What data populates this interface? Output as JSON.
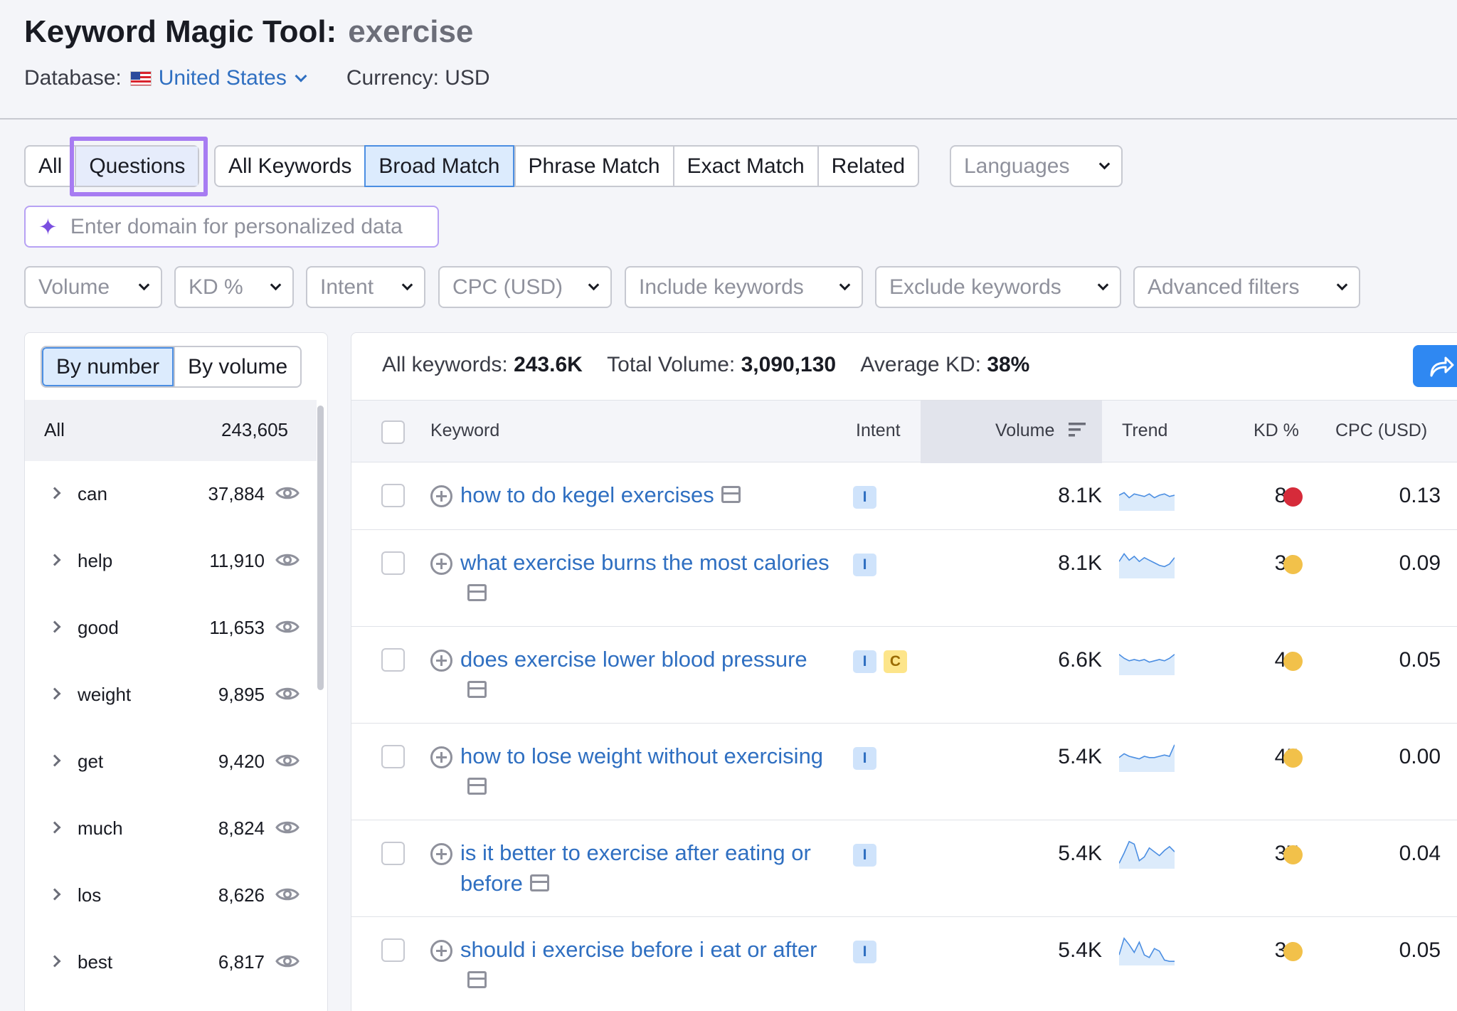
{
  "header": {
    "title": "Keyword Magic Tool:",
    "keyword": "exercise",
    "database_label": "Database:",
    "database_value": "United States",
    "currency": "Currency: USD"
  },
  "tabs_group1": [
    "All",
    "Questions"
  ],
  "tabs_group2": [
    "All Keywords",
    "Broad Match",
    "Phrase Match",
    "Exact Match",
    "Related"
  ],
  "languages_label": "Languages",
  "domain_input_placeholder": "Enter domain for personalized data",
  "filters": [
    "Volume",
    "KD %",
    "Intent",
    "CPC (USD)",
    "Include keywords",
    "Exclude keywords",
    "Advanced filters"
  ],
  "left_panel": {
    "toggle": [
      "By number",
      "By volume"
    ],
    "all_label": "All",
    "all_count": "243,605",
    "groups": [
      {
        "name": "can",
        "count": "37,884"
      },
      {
        "name": "help",
        "count": "11,910"
      },
      {
        "name": "good",
        "count": "11,653"
      },
      {
        "name": "weight",
        "count": "9,895"
      },
      {
        "name": "get",
        "count": "9,420"
      },
      {
        "name": "much",
        "count": "8,824"
      },
      {
        "name": "los",
        "count": "8,626"
      },
      {
        "name": "best",
        "count": "6,817"
      }
    ]
  },
  "summary": {
    "all_keywords_label": "All keywords:",
    "all_keywords_value": "243.6K",
    "total_volume_label": "Total Volume:",
    "total_volume_value": "3,090,130",
    "avg_kd_label": "Average KD:",
    "avg_kd_value": "38%"
  },
  "table": {
    "headers": {
      "keyword": "Keyword",
      "intent": "Intent",
      "volume": "Volume",
      "trend": "Trend",
      "kd": "KD %",
      "cpc": "CPC (USD)"
    },
    "rows": [
      {
        "keyword": "how to do kegel exercises",
        "intent": [
          "I"
        ],
        "volume": "8.1K",
        "kd": "88",
        "kd_color": "#d62b3a",
        "cpc": "0.13",
        "trend": [
          0.5,
          0.6,
          0.4,
          0.55,
          0.5,
          0.45,
          0.55,
          0.4,
          0.5,
          0.55,
          0.45,
          0.5
        ]
      },
      {
        "keyword": "what exercise burns the most calories",
        "intent": [
          "I"
        ],
        "volume": "8.1K",
        "kd": "38",
        "kd_color": "#f2c14a",
        "cpc": "0.09",
        "trend": [
          0.55,
          0.85,
          0.6,
          0.75,
          0.55,
          0.7,
          0.6,
          0.5,
          0.4,
          0.35,
          0.45,
          0.7
        ]
      },
      {
        "keyword": "does exercise lower blood pressure",
        "intent": [
          "I",
          "C"
        ],
        "volume": "6.6K",
        "kd": "48",
        "kd_color": "#f2c14a",
        "cpc": "0.05",
        "trend": [
          0.7,
          0.55,
          0.45,
          0.5,
          0.45,
          0.5,
          0.4,
          0.45,
          0.5,
          0.45,
          0.55,
          0.7
        ]
      },
      {
        "keyword": "how to lose weight without exercising",
        "intent": [
          "I"
        ],
        "volume": "5.4K",
        "kd": "45",
        "kd_color": "#f2c14a",
        "cpc": "0.00",
        "trend": [
          0.45,
          0.6,
          0.5,
          0.45,
          0.4,
          0.5,
          0.45,
          0.45,
          0.5,
          0.55,
          0.5,
          0.95
        ]
      },
      {
        "keyword": "is it better to exercise after eating or before",
        "intent": [
          "I"
        ],
        "volume": "5.4K",
        "kd": "37",
        "kd_color": "#f2c14a",
        "cpc": "0.04",
        "trend": [
          0.1,
          0.5,
          0.95,
          0.85,
          0.2,
          0.35,
          0.7,
          0.55,
          0.4,
          0.6,
          0.75,
          0.55
        ]
      },
      {
        "keyword": "should i exercise before i eat or after",
        "intent": [
          "I"
        ],
        "volume": "5.4K",
        "kd": "32",
        "kd_color": "#f2c14a",
        "cpc": "0.05",
        "trend": [
          0.3,
          0.95,
          0.7,
          0.4,
          0.8,
          0.3,
          0.2,
          0.55,
          0.45,
          0.1,
          0.05,
          0.05
        ]
      }
    ]
  }
}
